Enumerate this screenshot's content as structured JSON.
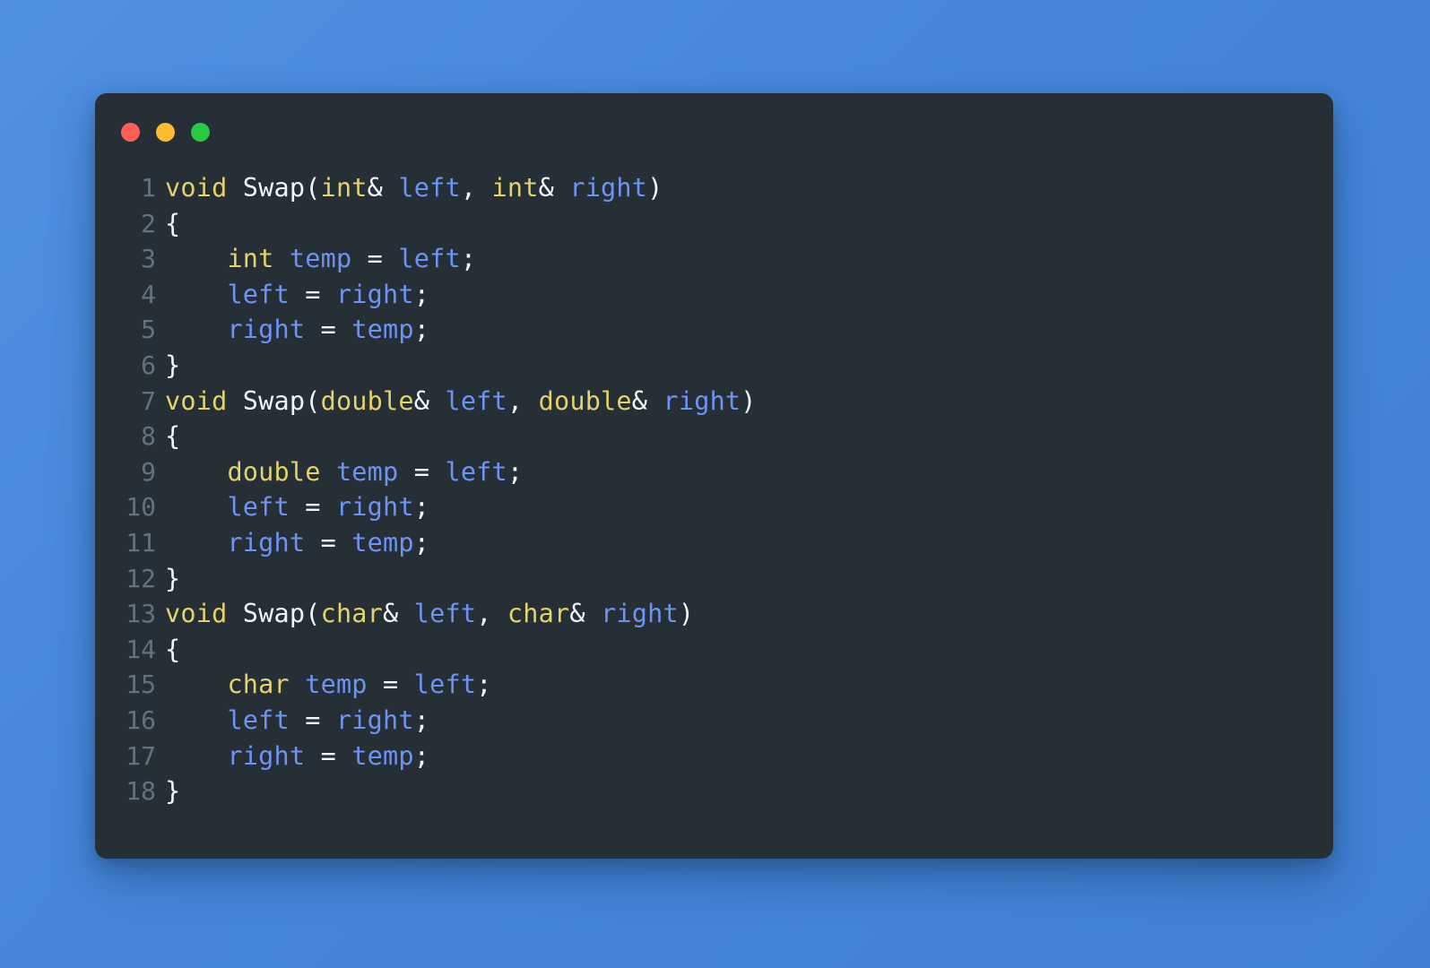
{
  "window": {
    "background_color": "#4586dc",
    "editor_background": "#262f36",
    "corner_radius_px": 13,
    "traffic_lights": [
      {
        "name": "close",
        "color": "#ff5f57"
      },
      {
        "name": "minimize",
        "color": "#febc2e"
      },
      {
        "name": "maximize",
        "color": "#28c840"
      }
    ]
  },
  "theme": {
    "gutter_color": "#60747f",
    "keyword_color": "#e3d36a",
    "function_color": "#f2f5f7",
    "identifier_color": "#6d93f4",
    "punctuation_color": "#f2f5f7"
  },
  "code": {
    "language": "cpp",
    "line_count": 18,
    "lines": [
      {
        "number": "1",
        "text": "void Swap(int& left, int& right)",
        "tokens": [
          {
            "t": "void",
            "c": "kw"
          },
          {
            "t": " ",
            "c": "plain"
          },
          {
            "t": "Swap",
            "c": "fn"
          },
          {
            "t": "(",
            "c": "punc"
          },
          {
            "t": "int",
            "c": "kw"
          },
          {
            "t": "&",
            "c": "punc"
          },
          {
            "t": " ",
            "c": "plain"
          },
          {
            "t": "left",
            "c": "id"
          },
          {
            "t": ",",
            "c": "punc"
          },
          {
            "t": " ",
            "c": "plain"
          },
          {
            "t": "int",
            "c": "kw"
          },
          {
            "t": "&",
            "c": "punc"
          },
          {
            "t": " ",
            "c": "plain"
          },
          {
            "t": "right",
            "c": "id"
          },
          {
            "t": ")",
            "c": "punc"
          }
        ]
      },
      {
        "number": "2",
        "text": "{",
        "tokens": [
          {
            "t": "{",
            "c": "punc"
          }
        ]
      },
      {
        "number": "3",
        "text": "    int temp = left;",
        "tokens": [
          {
            "t": "    ",
            "c": "plain"
          },
          {
            "t": "int",
            "c": "kw"
          },
          {
            "t": " ",
            "c": "plain"
          },
          {
            "t": "temp",
            "c": "id"
          },
          {
            "t": " ",
            "c": "plain"
          },
          {
            "t": "=",
            "c": "punc"
          },
          {
            "t": " ",
            "c": "plain"
          },
          {
            "t": "left",
            "c": "id"
          },
          {
            "t": ";",
            "c": "punc"
          }
        ]
      },
      {
        "number": "4",
        "text": "    left = right;",
        "tokens": [
          {
            "t": "    ",
            "c": "plain"
          },
          {
            "t": "left",
            "c": "id"
          },
          {
            "t": " ",
            "c": "plain"
          },
          {
            "t": "=",
            "c": "punc"
          },
          {
            "t": " ",
            "c": "plain"
          },
          {
            "t": "right",
            "c": "id"
          },
          {
            "t": ";",
            "c": "punc"
          }
        ]
      },
      {
        "number": "5",
        "text": "    right = temp;",
        "tokens": [
          {
            "t": "    ",
            "c": "plain"
          },
          {
            "t": "right",
            "c": "id"
          },
          {
            "t": " ",
            "c": "plain"
          },
          {
            "t": "=",
            "c": "punc"
          },
          {
            "t": " ",
            "c": "plain"
          },
          {
            "t": "temp",
            "c": "id"
          },
          {
            "t": ";",
            "c": "punc"
          }
        ]
      },
      {
        "number": "6",
        "text": "}",
        "tokens": [
          {
            "t": "}",
            "c": "punc"
          }
        ]
      },
      {
        "number": "7",
        "text": "void Swap(double& left, double& right)",
        "tokens": [
          {
            "t": "void",
            "c": "kw"
          },
          {
            "t": " ",
            "c": "plain"
          },
          {
            "t": "Swap",
            "c": "fn"
          },
          {
            "t": "(",
            "c": "punc"
          },
          {
            "t": "double",
            "c": "kw"
          },
          {
            "t": "&",
            "c": "punc"
          },
          {
            "t": " ",
            "c": "plain"
          },
          {
            "t": "left",
            "c": "id"
          },
          {
            "t": ",",
            "c": "punc"
          },
          {
            "t": " ",
            "c": "plain"
          },
          {
            "t": "double",
            "c": "kw"
          },
          {
            "t": "&",
            "c": "punc"
          },
          {
            "t": " ",
            "c": "plain"
          },
          {
            "t": "right",
            "c": "id"
          },
          {
            "t": ")",
            "c": "punc"
          }
        ]
      },
      {
        "number": "8",
        "text": "{",
        "tokens": [
          {
            "t": "{",
            "c": "punc"
          }
        ]
      },
      {
        "number": "9",
        "text": "    double temp = left;",
        "tokens": [
          {
            "t": "    ",
            "c": "plain"
          },
          {
            "t": "double",
            "c": "kw"
          },
          {
            "t": " ",
            "c": "plain"
          },
          {
            "t": "temp",
            "c": "id"
          },
          {
            "t": " ",
            "c": "plain"
          },
          {
            "t": "=",
            "c": "punc"
          },
          {
            "t": " ",
            "c": "plain"
          },
          {
            "t": "left",
            "c": "id"
          },
          {
            "t": ";",
            "c": "punc"
          }
        ]
      },
      {
        "number": "10",
        "text": "    left = right;",
        "tokens": [
          {
            "t": "    ",
            "c": "plain"
          },
          {
            "t": "left",
            "c": "id"
          },
          {
            "t": " ",
            "c": "plain"
          },
          {
            "t": "=",
            "c": "punc"
          },
          {
            "t": " ",
            "c": "plain"
          },
          {
            "t": "right",
            "c": "id"
          },
          {
            "t": ";",
            "c": "punc"
          }
        ]
      },
      {
        "number": "11",
        "text": "    right = temp;",
        "tokens": [
          {
            "t": "    ",
            "c": "plain"
          },
          {
            "t": "right",
            "c": "id"
          },
          {
            "t": " ",
            "c": "plain"
          },
          {
            "t": "=",
            "c": "punc"
          },
          {
            "t": " ",
            "c": "plain"
          },
          {
            "t": "temp",
            "c": "id"
          },
          {
            "t": ";",
            "c": "punc"
          }
        ]
      },
      {
        "number": "12",
        "text": "}",
        "tokens": [
          {
            "t": "}",
            "c": "punc"
          }
        ]
      },
      {
        "number": "13",
        "text": "void Swap(char& left, char& right)",
        "tokens": [
          {
            "t": "void",
            "c": "kw"
          },
          {
            "t": " ",
            "c": "plain"
          },
          {
            "t": "Swap",
            "c": "fn"
          },
          {
            "t": "(",
            "c": "punc"
          },
          {
            "t": "char",
            "c": "kw"
          },
          {
            "t": "&",
            "c": "punc"
          },
          {
            "t": " ",
            "c": "plain"
          },
          {
            "t": "left",
            "c": "id"
          },
          {
            "t": ",",
            "c": "punc"
          },
          {
            "t": " ",
            "c": "plain"
          },
          {
            "t": "char",
            "c": "kw"
          },
          {
            "t": "&",
            "c": "punc"
          },
          {
            "t": " ",
            "c": "plain"
          },
          {
            "t": "right",
            "c": "id"
          },
          {
            "t": ")",
            "c": "punc"
          }
        ]
      },
      {
        "number": "14",
        "text": "{",
        "tokens": [
          {
            "t": "{",
            "c": "punc"
          }
        ]
      },
      {
        "number": "15",
        "text": "    char temp = left;",
        "tokens": [
          {
            "t": "    ",
            "c": "plain"
          },
          {
            "t": "char",
            "c": "kw"
          },
          {
            "t": " ",
            "c": "plain"
          },
          {
            "t": "temp",
            "c": "id"
          },
          {
            "t": " ",
            "c": "plain"
          },
          {
            "t": "=",
            "c": "punc"
          },
          {
            "t": " ",
            "c": "plain"
          },
          {
            "t": "left",
            "c": "id"
          },
          {
            "t": ";",
            "c": "punc"
          }
        ]
      },
      {
        "number": "16",
        "text": "    left = right;",
        "tokens": [
          {
            "t": "    ",
            "c": "plain"
          },
          {
            "t": "left",
            "c": "id"
          },
          {
            "t": " ",
            "c": "plain"
          },
          {
            "t": "=",
            "c": "punc"
          },
          {
            "t": " ",
            "c": "plain"
          },
          {
            "t": "right",
            "c": "id"
          },
          {
            "t": ";",
            "c": "punc"
          }
        ]
      },
      {
        "number": "17",
        "text": "    right = temp;",
        "tokens": [
          {
            "t": "    ",
            "c": "plain"
          },
          {
            "t": "right",
            "c": "id"
          },
          {
            "t": " ",
            "c": "plain"
          },
          {
            "t": "=",
            "c": "punc"
          },
          {
            "t": " ",
            "c": "plain"
          },
          {
            "t": "temp",
            "c": "id"
          },
          {
            "t": ";",
            "c": "punc"
          }
        ]
      },
      {
        "number": "18",
        "text": "}",
        "tokens": [
          {
            "t": "}",
            "c": "punc"
          }
        ]
      }
    ]
  }
}
